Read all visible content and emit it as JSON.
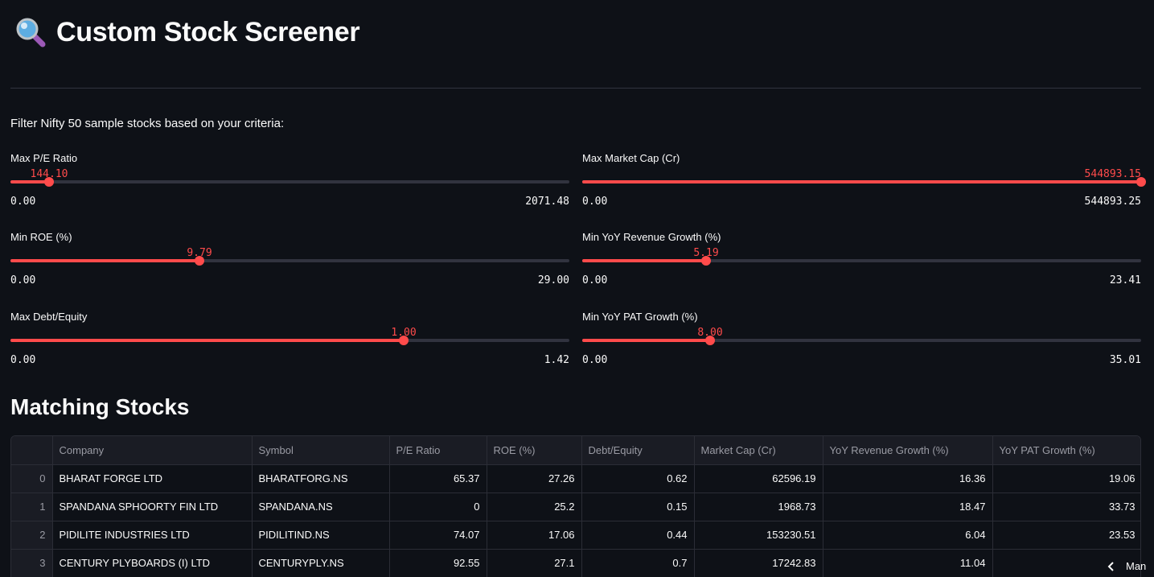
{
  "header": {
    "title": "Custom Stock Screener",
    "icon": "magnifying-glass-icon"
  },
  "intro": "Filter Nifty 50 sample stocks based on your criteria:",
  "accent_color": "#ff4b4b",
  "sliders": [
    {
      "label": "Max P/E Ratio",
      "value": "144.10",
      "min": "0.00",
      "max": "2071.48",
      "fraction": 0.0696
    },
    {
      "label": "Max Market Cap (Cr)",
      "value": "544893.15",
      "min": "0.00",
      "max": "544893.25",
      "fraction": 1.0
    },
    {
      "label": "Min ROE (%)",
      "value": "9.79",
      "min": "0.00",
      "max": "29.00",
      "fraction": 0.3376
    },
    {
      "label": "Min YoY Revenue Growth (%)",
      "value": "5.19",
      "min": "0.00",
      "max": "23.41",
      "fraction": 0.2217
    },
    {
      "label": "Max Debt/Equity",
      "value": "1.00",
      "min": "0.00",
      "max": "1.42",
      "fraction": 0.7042
    },
    {
      "label": "Min YoY PAT Growth (%)",
      "value": "8.00",
      "min": "0.00",
      "max": "35.01",
      "fraction": 0.2285
    }
  ],
  "results": {
    "title": "Matching Stocks",
    "columns": [
      "",
      "Company",
      "Symbol",
      "P/E Ratio",
      "ROE (%)",
      "Debt/Equity",
      "Market Cap (Cr)",
      "YoY Revenue Growth (%)",
      "YoY PAT Growth (%)"
    ],
    "rows": [
      [
        "0",
        "BHARAT FORGE LTD",
        "BHARATFORG.NS",
        "65.37",
        "27.26",
        "0.62",
        "62596.19",
        "16.36",
        "19.06"
      ],
      [
        "1",
        "SPANDANA SPHOORTY FIN LTD",
        "SPANDANA.NS",
        "0",
        "25.2",
        "0.15",
        "1968.73",
        "18.47",
        "33.73"
      ],
      [
        "2",
        "PIDILITE INDUSTRIES LTD",
        "PIDILITIND.NS",
        "74.07",
        "17.06",
        "0.44",
        "153230.51",
        "6.04",
        "23.53"
      ],
      [
        "3",
        "CENTURY PLYBOARDS (I) LTD",
        "CENTURYPLY.NS",
        "92.55",
        "27.1",
        "0.7",
        "17242.83",
        "11.04",
        ""
      ]
    ]
  },
  "mini_nav": {
    "label": "Man"
  }
}
